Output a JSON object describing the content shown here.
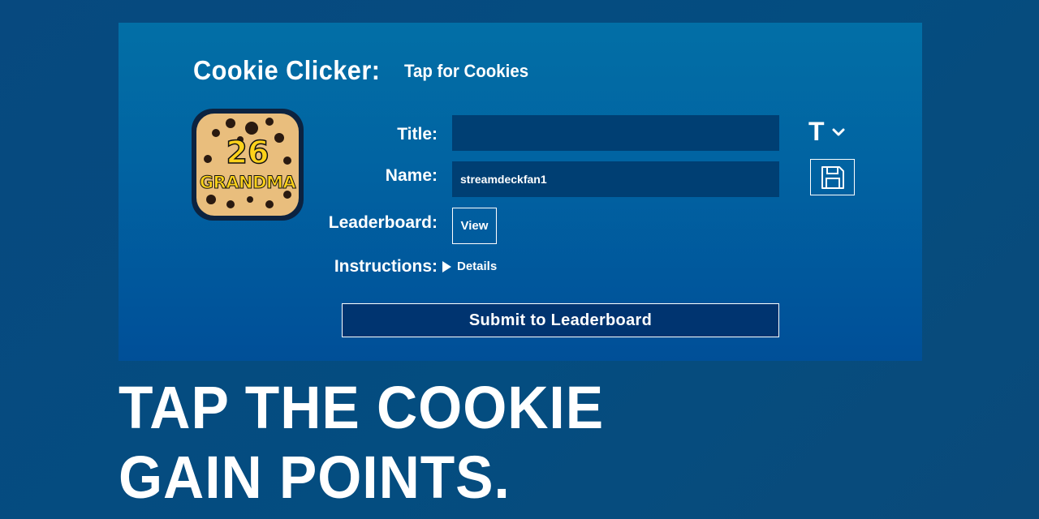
{
  "app": {
    "name": "Cookie Clicker:",
    "subtitle": "Tap for Cookies"
  },
  "game_icon": {
    "level": "26",
    "rank": "GRANDMA",
    "icon": "cookie-icon"
  },
  "form": {
    "title_label": "Title:",
    "title_value": "",
    "name_label": "Name:",
    "name_value": "streamdeckfan1",
    "leaderboard_label": "Leaderboard:",
    "view_label": "View",
    "instructions_label": "Instructions:",
    "details_label": "Details",
    "submit_label": "Submit to Leaderboard"
  },
  "side_controls": {
    "font_label": "T",
    "font_icon": "chevron-down-icon",
    "save_icon": "floppy-disk-icon"
  },
  "tagline": {
    "line1": "TAP THE COOKIE",
    "line2": "GAIN POINTS."
  },
  "colors": {
    "page_bg": "#044d80",
    "panel_top": "#026fa6",
    "panel_bottom": "#004f98",
    "input_bg": "#003f73",
    "submit_bg": "#003470",
    "badge_text": "#ffd21a",
    "cookie": "#e9be7d"
  }
}
